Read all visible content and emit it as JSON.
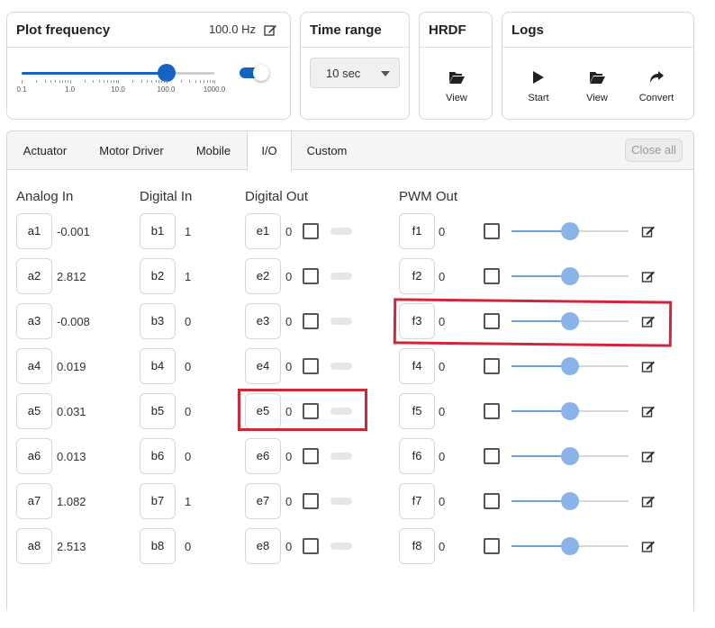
{
  "plot_frequency": {
    "title": "Plot frequency",
    "value": "100.0 Hz",
    "slider_ticks": [
      "0.1",
      "1.0",
      "10.0",
      "100.0",
      "1000.0"
    ],
    "slider_value_hz": 100.0,
    "slider_scale": "log",
    "toggle_on": true
  },
  "time_range": {
    "title": "Time range",
    "selected": "10 sec"
  },
  "hrdf": {
    "title": "HRDF",
    "view_label": "View"
  },
  "logs": {
    "title": "Logs",
    "start_label": "Start",
    "view_label": "View",
    "convert_label": "Convert"
  },
  "tabs": [
    "Actuator",
    "Motor Driver",
    "Mobile",
    "I/O",
    "Custom"
  ],
  "active_tab": "I/O",
  "close_all_label": "Close all",
  "columns": {
    "analog_in": "Analog In",
    "digital_in": "Digital In",
    "digital_out": "Digital Out",
    "pwm_out": "PWM Out"
  },
  "analog_in": [
    {
      "id": "a1",
      "value": "-0.001"
    },
    {
      "id": "a2",
      "value": "2.812"
    },
    {
      "id": "a3",
      "value": "-0.008"
    },
    {
      "id": "a4",
      "value": "0.019"
    },
    {
      "id": "a5",
      "value": "0.031"
    },
    {
      "id": "a6",
      "value": "0.013"
    },
    {
      "id": "a7",
      "value": "1.082"
    },
    {
      "id": "a8",
      "value": "2.513"
    }
  ],
  "digital_in": [
    {
      "id": "b1",
      "value": "1"
    },
    {
      "id": "b2",
      "value": "1"
    },
    {
      "id": "b3",
      "value": "0"
    },
    {
      "id": "b4",
      "value": "0"
    },
    {
      "id": "b5",
      "value": "0"
    },
    {
      "id": "b6",
      "value": "0"
    },
    {
      "id": "b7",
      "value": "1"
    },
    {
      "id": "b8",
      "value": "0"
    }
  ],
  "digital_out": [
    {
      "id": "e1",
      "value": "0"
    },
    {
      "id": "e2",
      "value": "0"
    },
    {
      "id": "e3",
      "value": "0"
    },
    {
      "id": "e4",
      "value": "0"
    },
    {
      "id": "e5",
      "value": "0"
    },
    {
      "id": "e6",
      "value": "0"
    },
    {
      "id": "e7",
      "value": "0"
    },
    {
      "id": "e8",
      "value": "0"
    }
  ],
  "pwm_out": [
    {
      "id": "f1",
      "value": "0",
      "slider_fraction": 0.5
    },
    {
      "id": "f2",
      "value": "0",
      "slider_fraction": 0.5
    },
    {
      "id": "f3",
      "value": "0",
      "slider_fraction": 0.5
    },
    {
      "id": "f4",
      "value": "0",
      "slider_fraction": 0.5
    },
    {
      "id": "f5",
      "value": "0",
      "slider_fraction": 0.5
    },
    {
      "id": "f6",
      "value": "0",
      "slider_fraction": 0.5
    },
    {
      "id": "f7",
      "value": "0",
      "slider_fraction": 0.5
    },
    {
      "id": "f8",
      "value": "0",
      "slider_fraction": 0.5
    }
  ],
  "highlight_color": "#d0263a",
  "accent_color": "#1565c0"
}
